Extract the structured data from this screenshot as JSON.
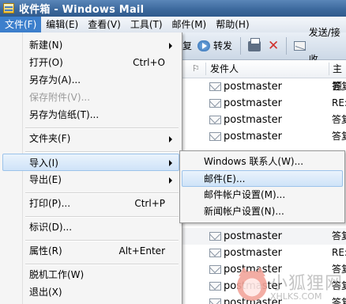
{
  "window": {
    "title": "收件箱 - Windows Mail"
  },
  "menubar": {
    "items": [
      {
        "label": "文件(F)",
        "active": true
      },
      {
        "label": "编辑(E)"
      },
      {
        "label": "查看(V)"
      },
      {
        "label": "工具(T)"
      },
      {
        "label": "邮件(M)"
      },
      {
        "label": "帮助(H)"
      }
    ]
  },
  "toolbar": {
    "partial_label": "复",
    "forward_label": "转发",
    "sendrecv_label": "发送/接收"
  },
  "list": {
    "columns": {
      "from": "发件人",
      "subject": "主题"
    },
    "rows": [
      {
        "from": "postmaster",
        "subject": "答复"
      },
      {
        "from": "postmaster",
        "subject": "RE:"
      },
      {
        "from": "postmaster",
        "subject": "答复"
      },
      {
        "from": "postmaster",
        "subject": "答复"
      },
      {
        "from": "postmaster",
        "subject": "答复"
      },
      {
        "from": "postmaster",
        "subject": "RE:"
      },
      {
        "from": "postmaster",
        "subject": "答复"
      },
      {
        "from": "postmaster",
        "subject": "答复"
      },
      {
        "from": "postmaster",
        "subject": "答复"
      },
      {
        "from": "postmaster",
        "subject": "答复"
      }
    ]
  },
  "file_menu": {
    "new": {
      "label": "新建(N)"
    },
    "open": {
      "label": "打开(O)",
      "shortcut": "Ctrl+O"
    },
    "save_as": {
      "label": "另存为(A)..."
    },
    "save_attachments": {
      "label": "保存附件(V)..."
    },
    "save_as_stationery": {
      "label": "另存为信纸(T)..."
    },
    "folder": {
      "label": "文件夹(F)"
    },
    "import": {
      "label": "导入(I)"
    },
    "export": {
      "label": "导出(E)"
    },
    "print": {
      "label": "打印(P)...",
      "shortcut": "Ctrl+P"
    },
    "identities": {
      "label": "标识(D)..."
    },
    "properties": {
      "label": "属性(R)",
      "shortcut": "Alt+Enter"
    },
    "work_offline": {
      "label": "脱机工作(W)"
    },
    "exit": {
      "label": "退出(X)"
    }
  },
  "import_submenu": {
    "items": [
      {
        "label": "Windows 联系人(W)..."
      },
      {
        "label": "邮件(E)..."
      },
      {
        "label": "邮件帐户设置(M)..."
      },
      {
        "label": "新闻帐户设置(N)..."
      }
    ]
  },
  "watermark": {
    "chinese": "小狐狸网",
    "english": "XHLKS.COM"
  },
  "colors": {
    "titlebar": "#3d6a9e",
    "menu_active": "#3c7fcc",
    "highlight": "#cfe3f8",
    "highlight_border": "#9cc3ea"
  }
}
